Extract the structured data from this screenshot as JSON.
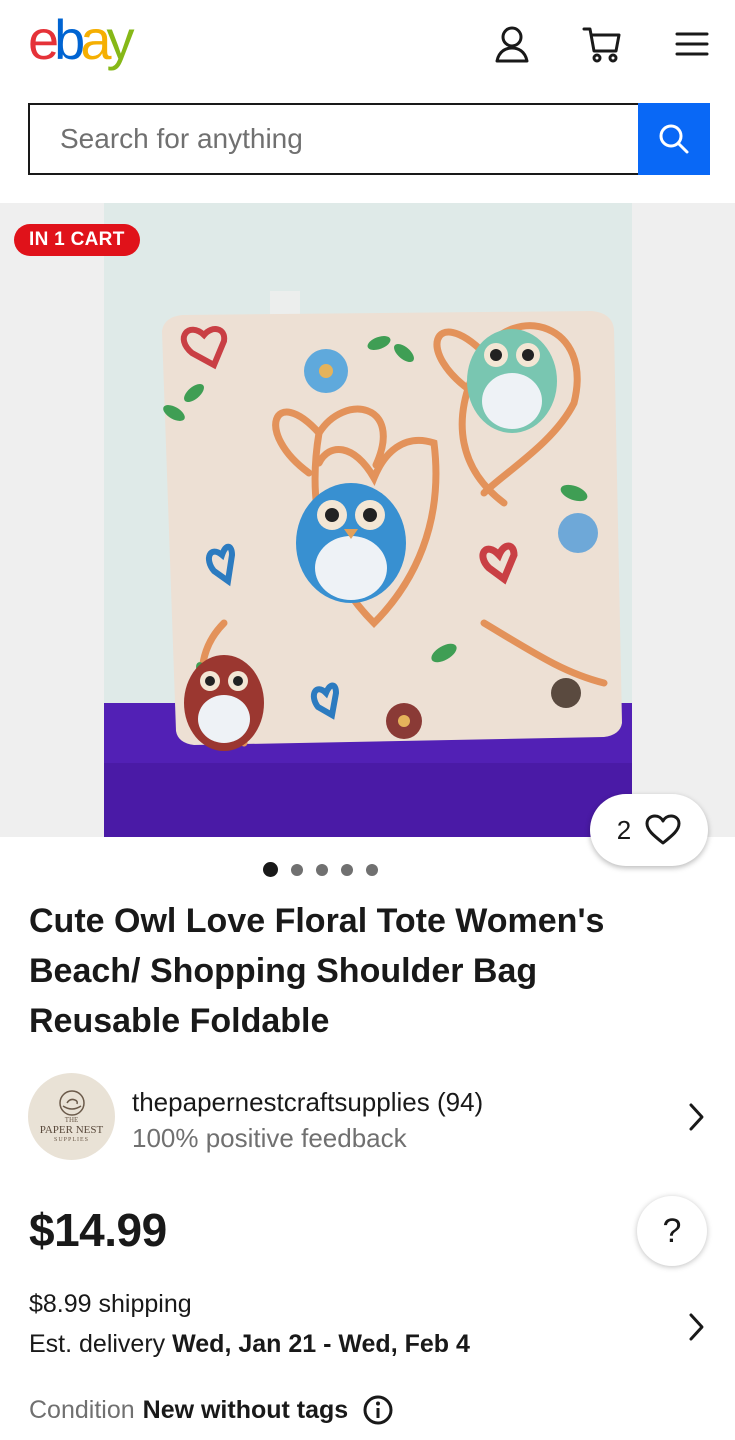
{
  "header": {
    "logo_letters": [
      {
        "ch": "e",
        "color": "#e53238"
      },
      {
        "ch": "b",
        "color": "#0064d2"
      },
      {
        "ch": "a",
        "color": "#f5af02"
      },
      {
        "ch": "y",
        "color": "#86b817"
      }
    ],
    "icons": [
      "account-icon",
      "cart-icon",
      "menu-icon"
    ]
  },
  "search": {
    "placeholder": "Search for anything",
    "button_color": "#0968f6"
  },
  "gallery": {
    "cart_badge": "IN 1 CART",
    "watch_count": "2",
    "image_count": 5,
    "active_index": 0
  },
  "listing": {
    "title": "Cute Owl Love Floral Tote Women's Beach/ Shopping Shoulder Bag Reusable Foldable",
    "seller": {
      "avatar_top": "THE",
      "avatar_name": "PAPER NEST",
      "avatar_bottom": "SUPPLIES",
      "name": "thepapernestcraftsupplies (94)",
      "feedback": "100% positive feedback"
    },
    "price": "$14.99",
    "help": "?",
    "shipping": "$8.99 shipping",
    "delivery_label": "Est. delivery",
    "delivery_dates": "Wed, Jan 21 - Wed, Feb 4",
    "condition_label": "Condition",
    "condition_value": "New without tags"
  },
  "colors": {
    "badge_red": "#e0121a",
    "text_primary": "#191919",
    "text_secondary": "#707070"
  }
}
